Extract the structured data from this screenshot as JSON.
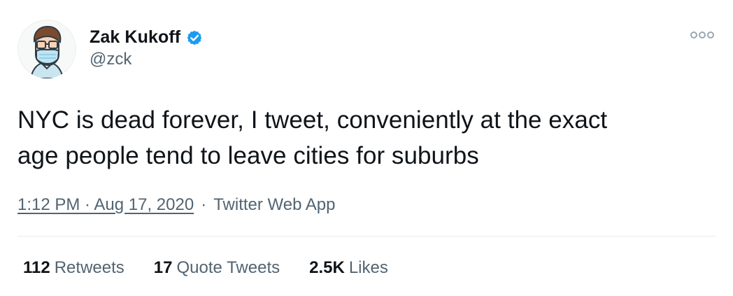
{
  "author": {
    "display_name": "Zak Kukoff",
    "handle": "@zck",
    "verified": true,
    "avatar_icon": "cartoon-man-with-glasses-and-mask-avatar"
  },
  "tweet": {
    "text": "NYC is dead forever, I tweet, conveniently at the exact\nage people tend to leave cities for suburbs"
  },
  "metadata": {
    "timestamp": "1:12 PM · Aug 17, 2020",
    "separator": "·",
    "source": "Twitter Web App"
  },
  "stats": {
    "retweets": {
      "value": "112",
      "label": "Retweets"
    },
    "quote_tweets": {
      "value": "17",
      "label": "Quote Tweets"
    },
    "likes": {
      "value": "2.5K",
      "label": "Likes"
    }
  },
  "icons": {
    "verified": "verified-badge-icon",
    "more": "more-options-icon"
  },
  "colors": {
    "primary_text": "#0f1419",
    "secondary_text": "#536471",
    "verified_blue": "#1d9bf0",
    "divider": "#e6ecf0"
  }
}
